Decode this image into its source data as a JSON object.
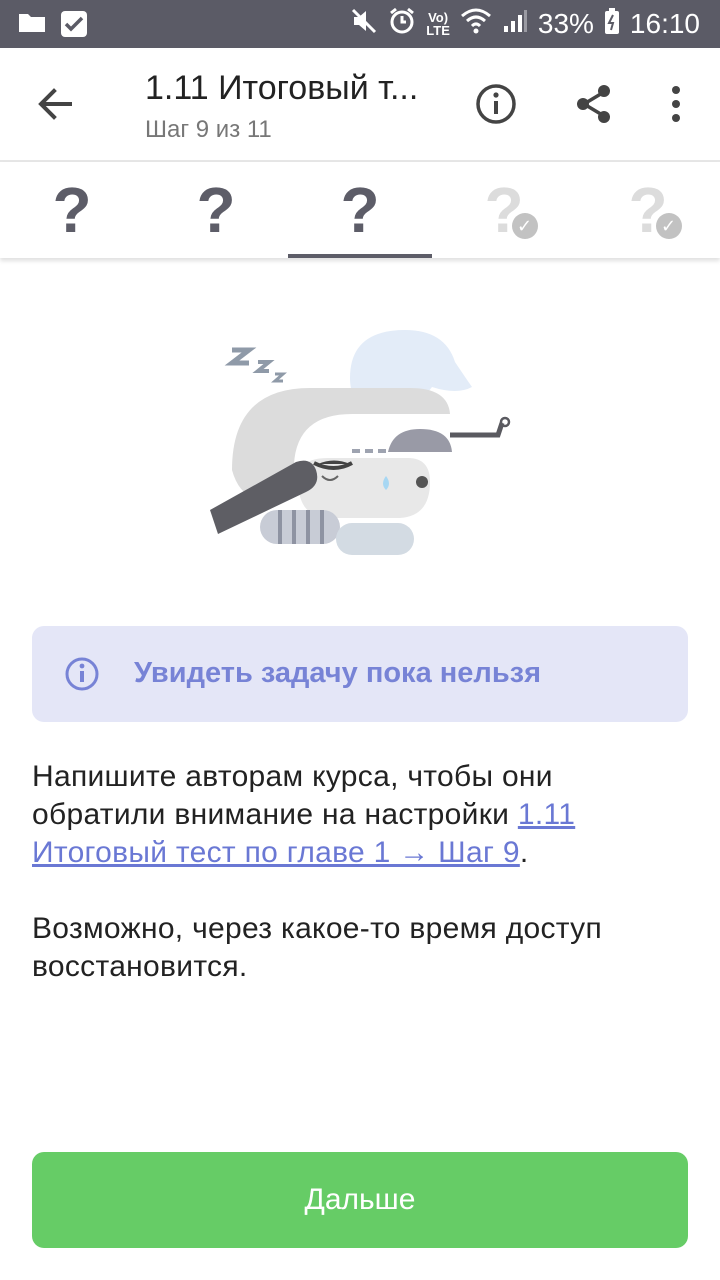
{
  "status_bar": {
    "battery": "33%",
    "time": "16:10",
    "network_label": "LTE",
    "icons": [
      "folder-icon",
      "checkbox-icon",
      "mute-icon",
      "alarm-icon",
      "volte-icon",
      "wifi-icon",
      "signal-icon",
      "battery-icon"
    ]
  },
  "header": {
    "title": "1.11 Итоговый т...",
    "subtitle": "Шаг 9 из 11"
  },
  "tabs": [
    {
      "symbol": "?",
      "state": "available"
    },
    {
      "symbol": "?",
      "state": "available"
    },
    {
      "symbol": "?",
      "state": "selected"
    },
    {
      "symbol": "?",
      "state": "locked-done"
    },
    {
      "symbol": "?",
      "state": "locked-done"
    }
  ],
  "notice": {
    "text": "Увидеть задачу пока нельзя"
  },
  "message": {
    "p1_prefix": "Напишите авторам курса, чтобы они обратили внимание на настройки ",
    "p1_link": "1.11 Итоговый тест по главе 1 → Шаг 9",
    "p1_suffix": ".",
    "p2": "Возможно, через какое-то время доступ восстановится."
  },
  "next_button": {
    "label": "Дальше"
  },
  "colors": {
    "status_bar": "#5b5b66",
    "notice_bg": "#e4e6f7",
    "notice_text": "#7783d6",
    "link": "#6a78d4",
    "button_green": "#66cc66"
  }
}
